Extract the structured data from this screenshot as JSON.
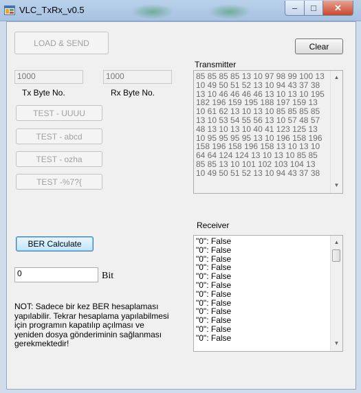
{
  "window": {
    "title": "VLC_TxRx_v0.5",
    "controls": {
      "minimize": "–",
      "maximize": "□",
      "close": "✕"
    }
  },
  "buttons": {
    "load_send": "LOAD & SEND",
    "clear": "Clear",
    "test_uuuu": "TEST - UUUU",
    "test_abcd": "TEST - abcd",
    "test_ozha": "TEST - ozha",
    "test_special": "TEST -%7?{",
    "ber_calculate": "BER Calculate"
  },
  "tx_byte": {
    "value": "1000",
    "label": "Tx Byte No."
  },
  "rx_byte": {
    "value": "1000",
    "label": "Rx Byte No."
  },
  "transmitter": {
    "label": "Transmitter",
    "lines": [
      "85 85 85 85 13 10 97 98 99 100 13",
      "10 49 50 51 52 13 10 94 43 37 38",
      "13 10 46 46 46 46 13 10 13 10 195",
      "182 196 159 195 188 197 159 13",
      "10 61 62 13 10 13 10 85 85 85 85",
      "13 10 53 54 55 56 13 10 57 48 57",
      "48 13 10 13 10 40 41 123 125 13",
      "10 95 95 95 95 13 10 196 158 196",
      "158 196 158 196 158 13 10 13 10",
      "64 64 124 124 13 10 13 10 85 85",
      "85 85 13 10 101 102 103 104 13",
      "10 49 50 51 52 13 10 94 43 37 38"
    ]
  },
  "receiver": {
    "label": "Receiver",
    "lines": [
      "\"0\": False",
      "\"0\": False",
      "\"0\": False",
      "\"0\": False",
      "\"0\": False",
      "\"0\": False",
      "\"0\": False",
      "\"0\": False",
      "\"0\": False",
      "\"0\": False",
      "\"0\": False",
      "\"0\": False"
    ]
  },
  "ber": {
    "value": "0",
    "unit": "Bit"
  },
  "note_lines": [
    "NOT: Sadece bir kez BER hesaplaması",
    "yapılabilir. Tekrar hesaplama yapılabilmesi",
    "için programın kapatılıp açılması ve",
    "yeniden dosya gönderiminin sağlanması",
    "gerekmektedir!"
  ],
  "icons": {
    "app": "app-window-icon",
    "scroll_up": "▲",
    "scroll_down": "▼"
  }
}
